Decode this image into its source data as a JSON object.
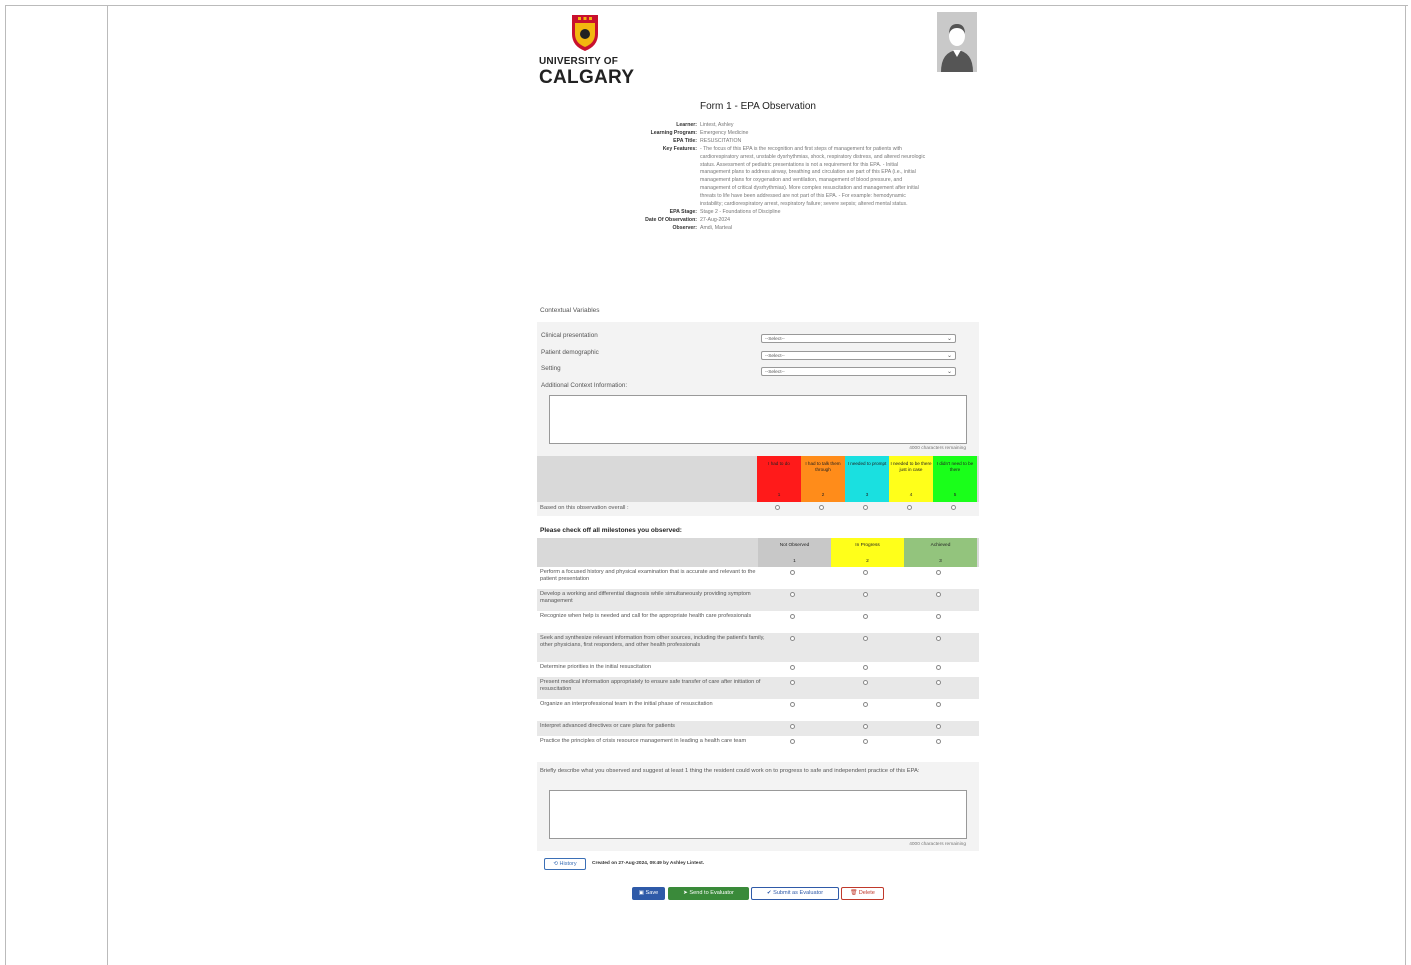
{
  "form": {
    "logo_line1": "UNIVERSITY OF",
    "logo_line2": "CALGARY",
    "title": "Form 1 - EPA Observation",
    "info": [
      {
        "label": "Learner:",
        "value": "Lintest, Ashley"
      },
      {
        "label": "Learning Program:",
        "value": "Emergency Medicine"
      },
      {
        "label": "EPA Title:",
        "value": "RESUSCITATION"
      },
      {
        "label": "Key Features:",
        "value": "- The focus of this EPA is the recognition and first steps of management for patients with cardiorespiratory arrest, unstable dysrhythmias, shock, respiratory distress, and altered neurologic status. Assessment of pediatric presentations is not a requirement for this EPA. - Initial management plans to address airway, breathing and circulation are part of this EPA (i.e., initial management plans for oxygenation and ventilation, management of blood pressure, and management of critical dysrhythmias). More complex resuscitation and management after initial threats to life have been addressed are not part of this EPA. - For example: hemodynamic instability; cardiorespiratory arrest, respiratory failure; severe sepsis; altered mental status."
      },
      {
        "label": "EPA Stage:",
        "value": "Stage 2 - Foundations of Discipline"
      },
      {
        "label": "Date Of Observation:",
        "value": "27-Aug-2024"
      },
      {
        "label": "Observer:",
        "value": "Amdi, Marteal"
      }
    ]
  },
  "context": {
    "heading": "Contextual Variables",
    "fields": [
      {
        "label": "Clinical presentation",
        "value": "--Select--"
      },
      {
        "label": "Patient demographic",
        "value": "--Select--"
      },
      {
        "label": "Setting",
        "value": "--Select--"
      }
    ],
    "additional_label": "Additional Context Information:",
    "remaining": "4000 characters remaining"
  },
  "scale": {
    "overall_label": "Based on this observation overall :",
    "options": [
      {
        "label": "I had to do",
        "num": "1",
        "color": "#ff1a1a"
      },
      {
        "label": "I had to talk them through",
        "num": "2",
        "color": "#ff8c1a"
      },
      {
        "label": "I needed to prompt",
        "num": "3",
        "color": "#1ae0e0"
      },
      {
        "label": "I needed to be there just in case",
        "num": "4",
        "color": "#ffff1a"
      },
      {
        "label": "I didn't need to be there",
        "num": "5",
        "color": "#1aff1a"
      }
    ]
  },
  "milestones": {
    "heading": "Please check off all milestones you observed:",
    "columns": [
      {
        "label": "Not Observed",
        "num": "1",
        "color": "#c8c8c8"
      },
      {
        "label": "In Progress",
        "num": "2",
        "color": "#ffff1a"
      },
      {
        "label": "Achieved",
        "num": "3",
        "color": "#93c47d"
      }
    ],
    "rows": [
      "Perform a focused history and physical examination that is accurate and relevant to the patient presentation",
      "Develop a working and differential diagnosis while simultaneously providing symptom management",
      "Recognize when help is needed and call for the appropriate health care professionals",
      "Seek and synthesize relevant information from other sources, including the patient's family, other physicians, first responders, and other health professionals",
      "Determine priorities in the initial resuscitation",
      "Present medical information appropriately to ensure safe transfer of care after initiation of resuscitation",
      "Organize an interprofessional team in the initial phase of resuscitation",
      "Interpret advanced directives or care plans for patients",
      "Practice the principles of crisis resource management in leading a health care team"
    ]
  },
  "narrative": {
    "label": "Briefly describe what you observed and suggest at least 1 thing the resident could work on to progress to safe and independent practice of this EPA:",
    "remaining": "4000 characters remaining"
  },
  "footer": {
    "history_label": "History",
    "created_text": "Created on 27-Aug-2024, 09:49 by Ashley Lintest.",
    "save_label": "Save",
    "send_label": "Send to Evaluator",
    "submit_label": "Submit as Evaluator",
    "delete_label": "Delete"
  }
}
